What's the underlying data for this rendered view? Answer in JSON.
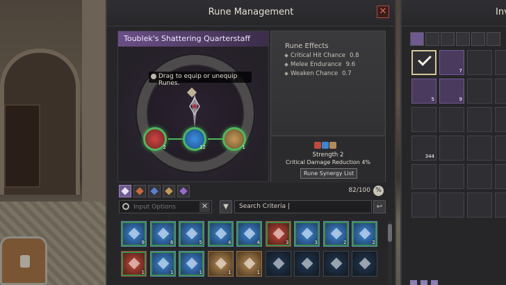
{
  "rune_window": {
    "title": "Rune Management",
    "close_glyph": "✕",
    "weapon_name": "Toublek's Shattering Quarterstaff",
    "drag_hint": "Drag to equip or unequip Runes.",
    "equipped_slots": [
      {
        "color": "red",
        "count": "2"
      },
      {
        "color": "blue",
        "count": "12"
      },
      {
        "color": "gold",
        "count": "1"
      }
    ],
    "effects_title": "Rune Effects",
    "effects": [
      {
        "name": "Critical Hit Chance",
        "value": "0.8"
      },
      {
        "name": "Melee Endurance",
        "value": "9.6"
      },
      {
        "name": "Weaken Chance",
        "value": "0.7"
      }
    ],
    "synergy": {
      "strength": "Strength 2",
      "description": "Critical Damage Reduction 4%",
      "button_label": "Rune Synergy List"
    },
    "filter_tabs": [
      "all",
      "red",
      "blue",
      "gold",
      "purple"
    ],
    "rune_count": "82/100",
    "count_button_glyph": "%",
    "search_placeholder": "Input Options",
    "clear_glyph": "✕",
    "filter_glyph": "▼",
    "criteria_text": "Search Criteria  |",
    "back_glyph": "↩",
    "runes": [
      {
        "color": "blue",
        "count": "9",
        "frame": "green"
      },
      {
        "color": "blue",
        "count": "6",
        "frame": "green"
      },
      {
        "color": "blue",
        "count": "5",
        "frame": "green"
      },
      {
        "color": "blue",
        "count": "4",
        "frame": "green"
      },
      {
        "color": "blue",
        "count": "4",
        "frame": "green"
      },
      {
        "color": "red",
        "count": "3",
        "frame": "green"
      },
      {
        "color": "blue",
        "count": "3",
        "frame": "green"
      },
      {
        "color": "blue",
        "count": "2",
        "frame": "green"
      },
      {
        "color": "blue",
        "count": "2",
        "frame": "green"
      },
      {
        "color": "red",
        "count": "1",
        "frame": "green"
      },
      {
        "color": "blue",
        "count": "1",
        "frame": "green"
      },
      {
        "color": "blue",
        "count": "1",
        "frame": "green"
      },
      {
        "color": "gold",
        "count": "1",
        "frame": "none"
      },
      {
        "color": "gold",
        "count": "1",
        "frame": "none"
      },
      {
        "color": "dim",
        "count": "",
        "frame": "none"
      },
      {
        "color": "dim",
        "count": "",
        "frame": "none"
      },
      {
        "color": "dim",
        "count": "",
        "frame": "none"
      },
      {
        "color": "dim",
        "count": "",
        "frame": "none"
      }
    ]
  },
  "inventory_window": {
    "title": "Inv",
    "items": [
      {
        "count": "",
        "style": "checked"
      },
      {
        "count": "7",
        "style": "purple"
      },
      {
        "count": "",
        "style": "plain"
      },
      {
        "count": "",
        "style": "plain"
      },
      {
        "count": "5",
        "style": "purple"
      },
      {
        "count": "9",
        "style": "purple"
      },
      {
        "count": "",
        "style": "plain"
      },
      {
        "count": "",
        "style": "plain"
      },
      {
        "count": "",
        "style": "plain"
      },
      {
        "count": "",
        "style": "plain"
      },
      {
        "count": "",
        "style": "plain"
      },
      {
        "count": "",
        "style": "plain"
      },
      {
        "count": "344",
        "style": "plain"
      },
      {
        "count": "",
        "style": "plain"
      },
      {
        "count": "",
        "style": "plain"
      },
      {
        "count": "",
        "style": "plain"
      },
      {
        "count": "",
        "style": "plain"
      },
      {
        "count": "",
        "style": "plain"
      },
      {
        "count": "",
        "style": "plain"
      },
      {
        "count": "",
        "style": "plain"
      },
      {
        "count": "",
        "style": "plain"
      },
      {
        "count": "",
        "style": "plain"
      },
      {
        "count": "",
        "style": "plain"
      },
      {
        "count": "",
        "style": "plain"
      }
    ]
  },
  "colors": {
    "accent_purple": "#6e5a8f",
    "equipped_green": "#4fb85e",
    "close_red": "#b24a3e"
  }
}
